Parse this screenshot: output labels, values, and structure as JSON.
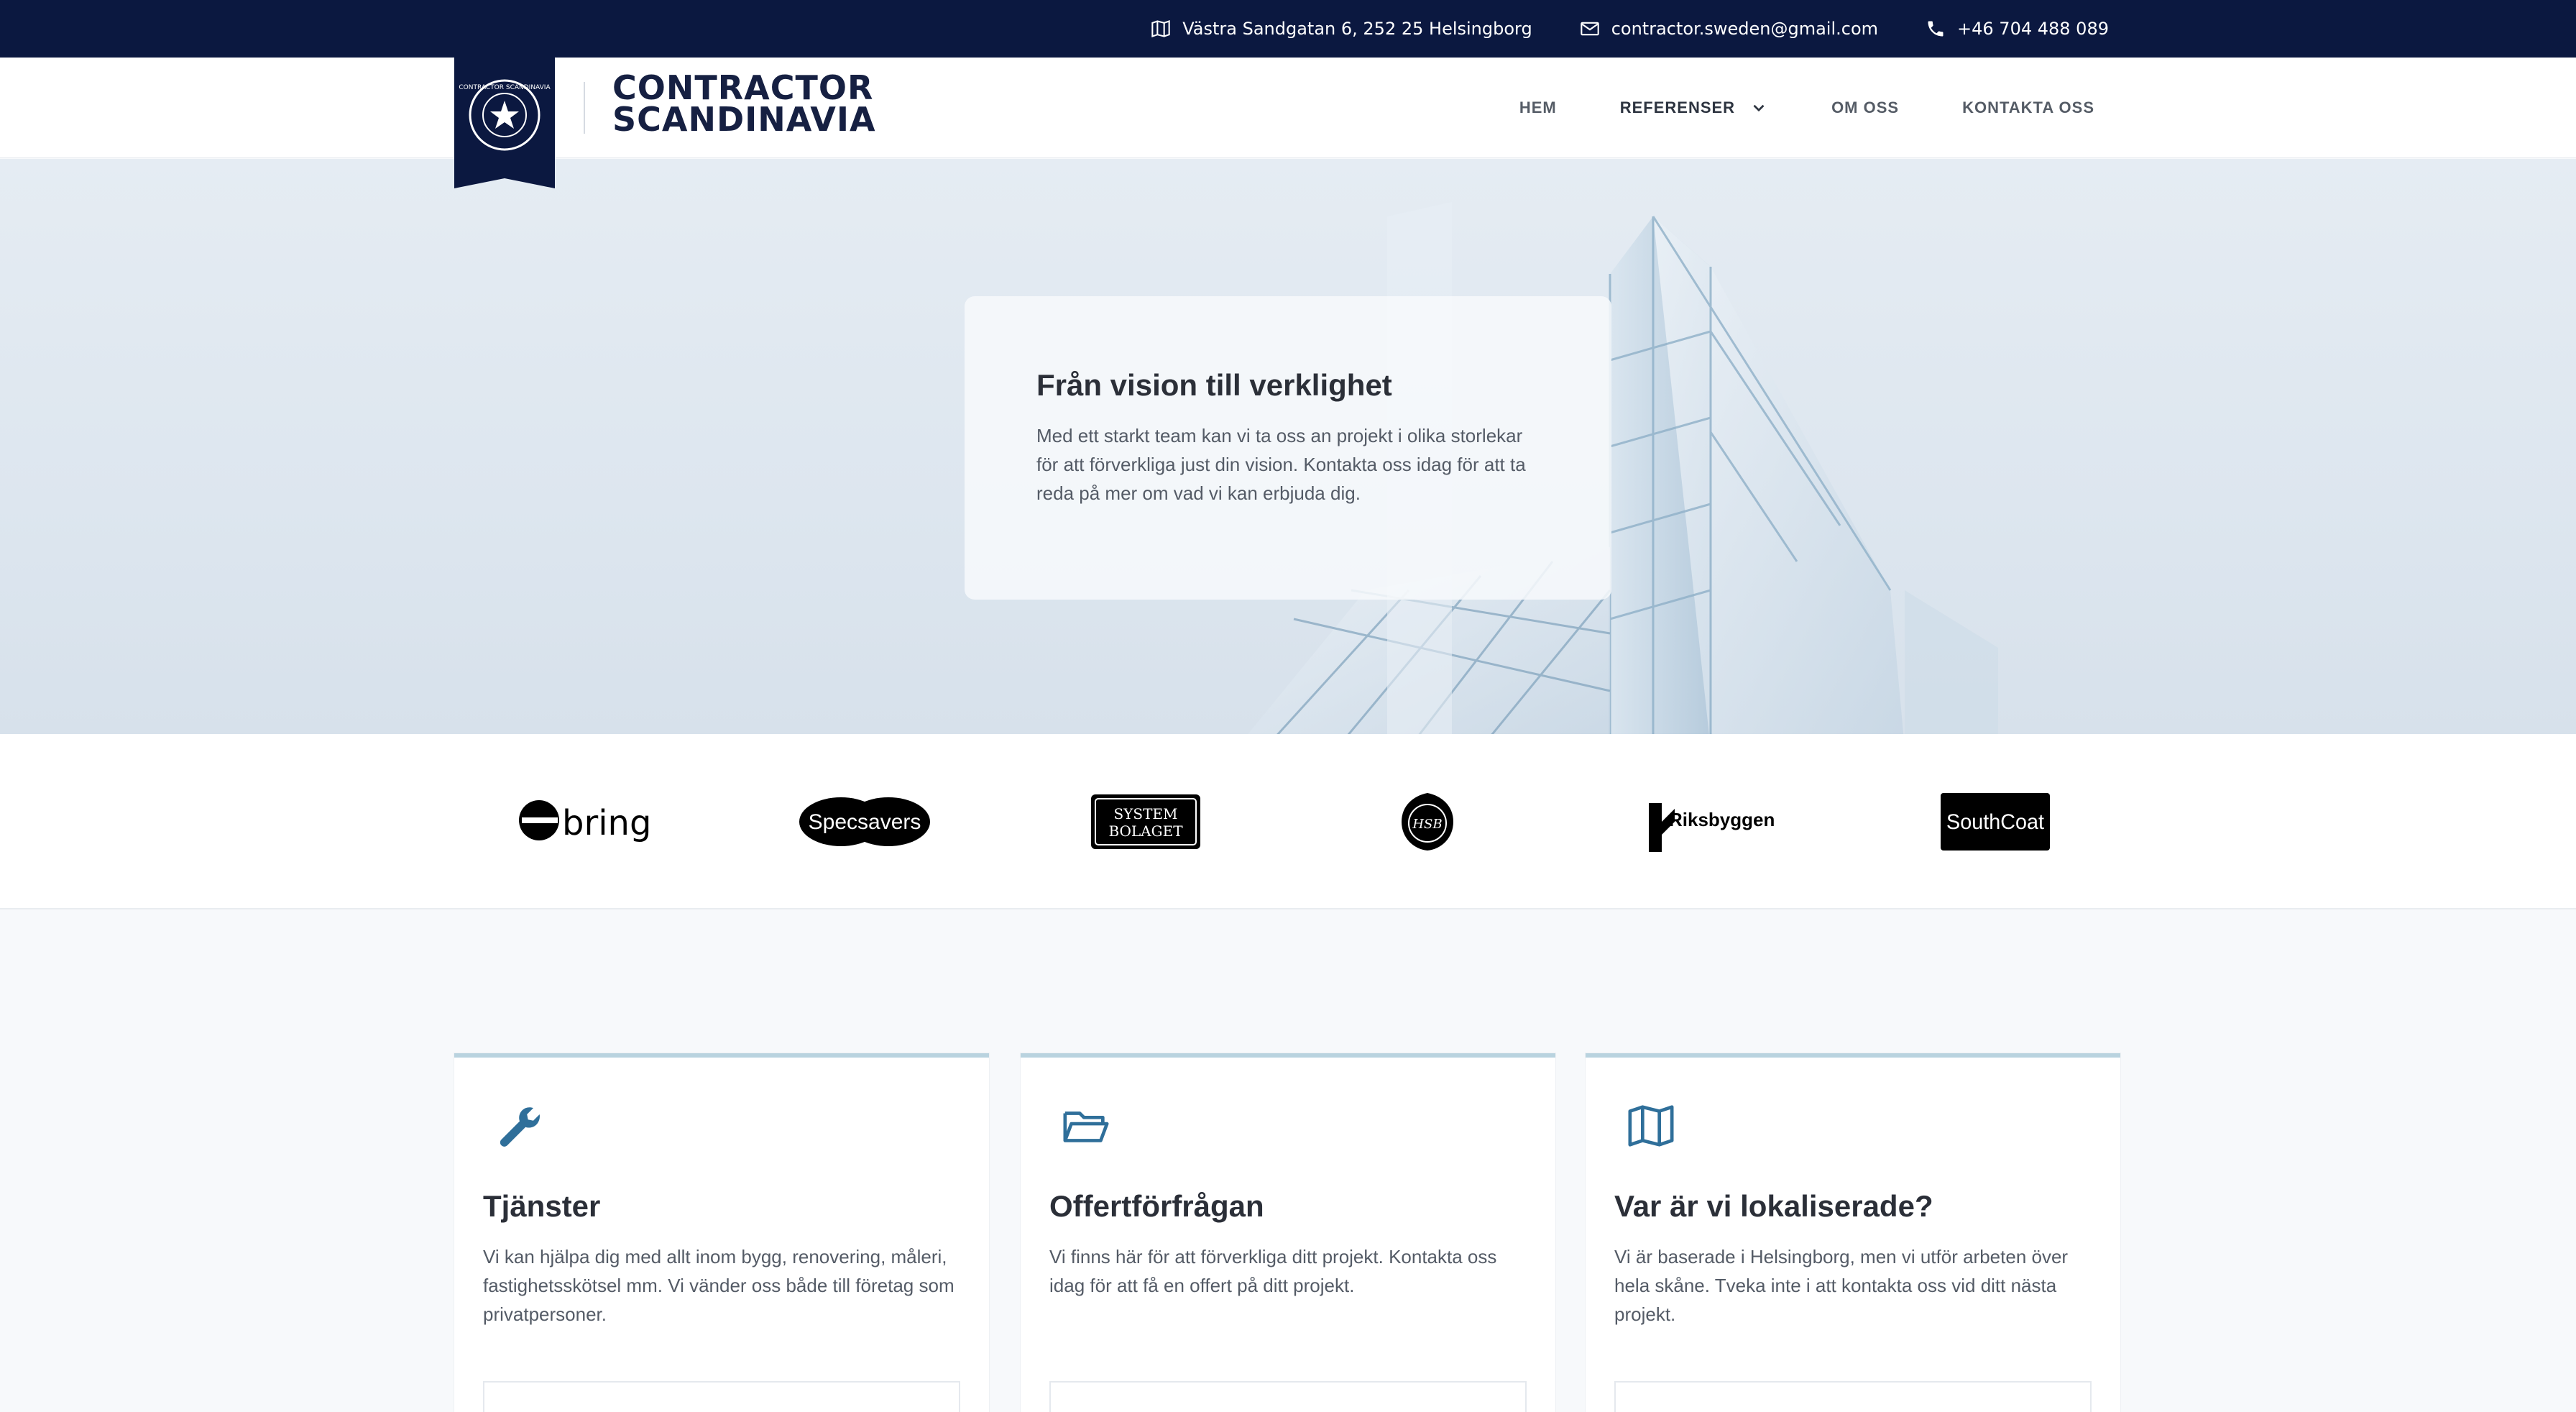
{
  "topbar": {
    "address": "Västra Sandgatan 6, 252 25 Helsingborg",
    "email": "contractor.sweden@gmail.com",
    "phone": "+46 704 488 089"
  },
  "brand": {
    "line1": "CONTRACTOR",
    "line2": "SCANDINAVIA",
    "badge_text": "CONTRACTOR SCANDINAVIA"
  },
  "nav": {
    "items": [
      {
        "label": "HEM"
      },
      {
        "label": "REFERENSER"
      },
      {
        "label": "OM OSS"
      },
      {
        "label": "KONTAKTA OSS"
      }
    ]
  },
  "hero": {
    "title": "Från vision till verklighet",
    "text": "Med ett starkt team kan vi ta oss an projekt i olika storlekar för att förverkliga just din vision. Kontakta oss idag för att ta reda på mer om vad vi kan erbjuda dig."
  },
  "clients": {
    "bring": "bring",
    "specsavers": "Specsavers",
    "systembolaget_1": "SYSTEM",
    "systembolaget_2": "BOLAGET",
    "hsb": "HSB",
    "riksbyggen": "Riksbyggen",
    "southcoat": "SouthCoat"
  },
  "cards": [
    {
      "title": "Tjänster",
      "text": "Vi kan hjälpa dig med allt inom bygg, renovering, måleri, fastighetsskötsel mm. Vi vänder oss både till företag som privatpersoner.",
      "icon": "wrench-icon"
    },
    {
      "title": "Offertförfrågan",
      "text": "Vi finns här för att förverkliga ditt projekt. Kontakta oss idag för att få en offert på ditt projekt.",
      "icon": "folder-open-icon"
    },
    {
      "title": "Var är vi lokaliserade?",
      "text": "Vi är baserade i Helsingborg, men vi utför arbeten över hela skåne. Tveka inte i att kontakta oss vid ditt nästa projekt.",
      "icon": "map-icon"
    }
  ],
  "colors": {
    "navy": "#0b1840",
    "accent": "#2f6f9a",
    "card_border": "#b9d3df"
  }
}
